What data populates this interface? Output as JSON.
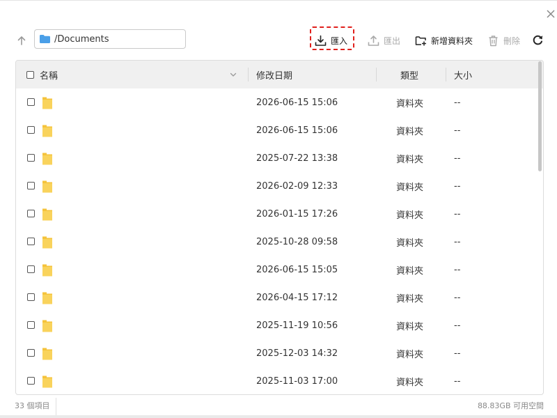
{
  "toolbar": {
    "path_value": "/Documents",
    "import_label": "匯入",
    "export_label": "匯出",
    "new_folder_label": "新增資料夾",
    "delete_label": "刪除"
  },
  "table": {
    "headers": {
      "name": "名稱",
      "modified": "修改日期",
      "type": "類型",
      "size": "大小"
    },
    "rows": [
      {
        "name": "",
        "modified": "2026-06-15 15:06",
        "type": "資料夾",
        "size": "--"
      },
      {
        "name": "",
        "modified": "2026-06-15 15:06",
        "type": "資料夾",
        "size": "--"
      },
      {
        "name": "",
        "modified": "2025-07-22 13:38",
        "type": "資料夾",
        "size": "--"
      },
      {
        "name": "",
        "modified": "2026-02-09 12:33",
        "type": "資料夾",
        "size": "--"
      },
      {
        "name": "",
        "modified": "2026-01-15 17:26",
        "type": "資料夾",
        "size": "--"
      },
      {
        "name": "",
        "modified": "2025-10-28 09:58",
        "type": "資料夾",
        "size": "--"
      },
      {
        "name": "",
        "modified": "2026-06-15 15:05",
        "type": "資料夾",
        "size": "--"
      },
      {
        "name": "",
        "modified": "2026-04-15 17:12",
        "type": "資料夾",
        "size": "--"
      },
      {
        "name": "",
        "modified": "2025-11-19 10:56",
        "type": "資料夾",
        "size": "--"
      },
      {
        "name": "",
        "modified": "2025-12-03 14:32",
        "type": "資料夾",
        "size": "--"
      },
      {
        "name": "",
        "modified": "2025-11-03 17:00",
        "type": "資料夾",
        "size": "--"
      }
    ]
  },
  "footer": {
    "item_count": "33 個項目",
    "free_space": "88.83GB 可用空間"
  },
  "colors": {
    "folder_yellow": "#f7c948",
    "path_folder_blue": "#4a9fe8",
    "highlight_red": "#e0201c",
    "header_bg": "#f0f0f0"
  },
  "icons": {
    "close": "close-icon",
    "up": "arrow-up-icon",
    "path_folder": "folder-icon",
    "import": "import-icon",
    "export": "export-icon",
    "new_folder": "new-folder-icon",
    "delete": "trash-icon",
    "refresh": "refresh-icon",
    "sort": "chevron-down-icon",
    "row_folder": "folder-icon"
  }
}
